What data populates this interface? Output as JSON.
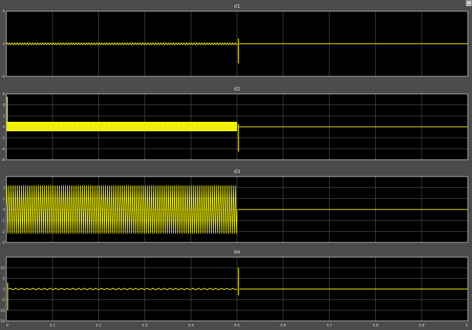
{
  "window": {
    "corner_icon": "maximize-icon"
  },
  "colors": {
    "background": "#4b4b4b",
    "axes_bg": "#000000",
    "grid": "#3c3c3c",
    "frame": "#b5b5b5",
    "signal": "#ffff00",
    "text": "#dcdcdc"
  },
  "chart_data": [
    {
      "type": "line",
      "title": "d1",
      "xlim": [
        0,
        1
      ],
      "ylim": [
        -5,
        5
      ],
      "yticks": [
        5,
        0,
        -5
      ],
      "ytick_labels": [
        "5",
        "0",
        "-5"
      ],
      "xticks": [
        0,
        0.1,
        0.2,
        0.3,
        0.4,
        0.5,
        0.6,
        0.7,
        0.8,
        0.9,
        1
      ],
      "xtick_labels": [],
      "grid": true,
      "series": [
        {
          "color": "#ffff00",
          "segments": [
            {
              "kind": "oscillation",
              "x": [
                0,
                0.5
              ],
              "center": 0,
              "amplitude": 0.15,
              "cycles": 90
            },
            {
              "kind": "spike",
              "x": 0.503,
              "min": -3.0,
              "max": 0.8
            },
            {
              "kind": "flat",
              "x": [
                0.505,
                1
              ],
              "value": 0
            }
          ]
        }
      ]
    },
    {
      "type": "line",
      "title": "d2",
      "xlim": [
        0,
        1
      ],
      "ylim": [
        -6,
        6
      ],
      "yticks": [
        6,
        4,
        2,
        0,
        -2,
        -4,
        -6
      ],
      "ytick_labels": [
        "6",
        "4",
        "2",
        "0",
        "-2",
        "-4",
        "-6"
      ],
      "xticks": [
        0,
        0.1,
        0.2,
        0.3,
        0.4,
        0.5,
        0.6,
        0.7,
        0.8,
        0.9,
        1
      ],
      "xtick_labels": [],
      "grid": true,
      "series": [
        {
          "color": "#ffff00",
          "segments": [
            {
              "kind": "spike",
              "x": 0.002,
              "min": 0,
              "max": 5.5
            },
            {
              "kind": "band",
              "x": [
                0,
                0.5
              ],
              "min": -0.8,
              "max": 0.9
            },
            {
              "kind": "spike",
              "x": 0.503,
              "min": -4.5,
              "max": 0.5
            },
            {
              "kind": "flat",
              "x": [
                0.505,
                1
              ],
              "value": 0
            }
          ]
        }
      ]
    },
    {
      "type": "line",
      "title": "d3",
      "xlim": [
        0,
        1
      ],
      "ylim": [
        -3,
        3
      ],
      "yticks": [
        3,
        2,
        1,
        0,
        -1,
        -2,
        -3
      ],
      "ytick_labels": [
        "",
        "2",
        "1",
        "0",
        "-1",
        "-2",
        "-3"
      ],
      "xticks": [
        0,
        0.1,
        0.2,
        0.3,
        0.4,
        0.5,
        0.6,
        0.7,
        0.8,
        0.9,
        1
      ],
      "xtick_labels": [],
      "grid": true,
      "series": [
        {
          "color": "#ffff00",
          "segments": [
            {
              "kind": "oscillation",
              "x": [
                0,
                0.5
              ],
              "center": 0,
              "amplitude": 2.2,
              "cycles": 110
            },
            {
              "kind": "flat",
              "x": [
                0.502,
                1
              ],
              "value": 0
            }
          ]
        }
      ]
    },
    {
      "type": "line",
      "title": "d4",
      "xlim": [
        0,
        1
      ],
      "ylim": [
        -15,
        15
      ],
      "yticks": [
        10,
        5,
        0,
        -5,
        -10,
        -15
      ],
      "ytick_labels": [
        "10",
        "5",
        "0",
        "-5",
        "-10",
        "-15"
      ],
      "xticks": [
        0,
        0.1,
        0.2,
        0.3,
        0.4,
        0.5,
        0.6,
        0.7,
        0.8,
        0.9,
        1
      ],
      "xtick_labels": [
        "0",
        "0.1",
        "0.2",
        "0.3",
        "0.4",
        "0.5",
        "0.6",
        "0.7",
        "0.8",
        "0.9",
        "1"
      ],
      "grid": true,
      "series": [
        {
          "color": "#ffff00",
          "segments": [
            {
              "kind": "spike",
              "x": 0.003,
              "min": -10,
              "max": 3
            },
            {
              "kind": "oscillation",
              "x": [
                0.005,
                0.5
              ],
              "center": 0,
              "amplitude": 0.4,
              "cycles": 40
            },
            {
              "kind": "spike",
              "x": 0.503,
              "min": -3,
              "max": 10
            },
            {
              "kind": "flat",
              "x": [
                0.506,
                1
              ],
              "value": 0
            }
          ]
        }
      ]
    }
  ]
}
